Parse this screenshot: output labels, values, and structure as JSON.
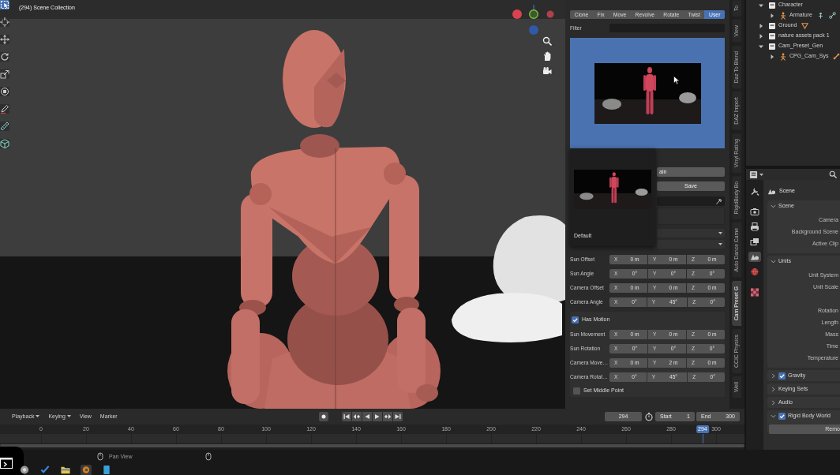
{
  "viewport": {
    "info": "(294) Scene Collection",
    "tools": [
      {
        "kind": "select",
        "selected": true
      },
      {
        "kind": "cursor",
        "selected": false
      },
      {
        "kind": "move",
        "selected": false
      },
      {
        "kind": "rotate",
        "selected": false
      },
      {
        "kind": "scale",
        "selected": false
      },
      {
        "kind": "transform",
        "selected": false
      },
      {
        "kind": "annotate",
        "selected": false
      },
      {
        "kind": "measure",
        "selected": false
      },
      {
        "kind": "add",
        "selected": false
      }
    ],
    "nav_buttons": [
      {
        "kind": "zoom"
      },
      {
        "kind": "pan"
      },
      {
        "kind": "camera"
      }
    ]
  },
  "n_panel": {
    "modes": [
      {
        "label": "Clone",
        "selected": false
      },
      {
        "label": "Fix",
        "selected": false
      },
      {
        "label": "Move",
        "selected": false
      },
      {
        "label": "Revolve",
        "selected": false
      },
      {
        "label": "Rotate",
        "selected": false
      },
      {
        "label": "Twist",
        "selected": false
      },
      {
        "label": "User",
        "selected": true
      }
    ],
    "filter": {
      "label": "Filter"
    },
    "popup": {
      "label": "Default"
    },
    "name_field": {
      "value": "ain"
    },
    "save_button": "Save",
    "offsets": [
      {
        "label": "Sun Offset",
        "values": [
          {
            "axis": "X",
            "value": "0 m"
          },
          {
            "axis": "Y",
            "value": "0 m"
          },
          {
            "axis": "Z",
            "value": "0 m"
          }
        ]
      },
      {
        "label": "Sun Angle",
        "values": [
          {
            "axis": "X",
            "value": "0°"
          },
          {
            "axis": "Y",
            "value": "0°"
          },
          {
            "axis": "Z",
            "value": "0°"
          }
        ]
      },
      {
        "label": "Camera Offset",
        "values": [
          {
            "axis": "X",
            "value": "0 m"
          },
          {
            "axis": "Y",
            "value": "0 m"
          },
          {
            "axis": "Z",
            "value": "0 m"
          }
        ]
      },
      {
        "label": "Camera Angle",
        "values": [
          {
            "axis": "X",
            "value": "0°"
          },
          {
            "axis": "Y",
            "value": "45°"
          },
          {
            "axis": "Z",
            "value": "0°"
          }
        ]
      }
    ],
    "has_motion": {
      "label": "Has Motion",
      "checked": true
    },
    "motion": [
      {
        "label": "Sun Movement",
        "values": [
          {
            "axis": "X",
            "value": "0 m"
          },
          {
            "axis": "Y",
            "value": "0 m"
          },
          {
            "axis": "Z",
            "value": "0 m"
          }
        ]
      },
      {
        "label": "Sun Rotation",
        "values": [
          {
            "axis": "X",
            "value": "0°"
          },
          {
            "axis": "Y",
            "value": "0°"
          },
          {
            "axis": "Z",
            "value": "0°"
          }
        ]
      },
      {
        "label": "Camera Move…",
        "values": [
          {
            "axis": "X",
            "value": "0 m"
          },
          {
            "axis": "Y",
            "value": "2 m"
          },
          {
            "axis": "Z",
            "value": "0 m"
          }
        ]
      },
      {
        "label": "Camera Rotat…",
        "values": [
          {
            "axis": "X",
            "value": "0°"
          },
          {
            "axis": "Y",
            "value": "45°"
          },
          {
            "axis": "Z",
            "value": "0°"
          }
        ]
      }
    ],
    "middle_point": {
      "label": "Set Middle Point",
      "checked": false
    }
  },
  "side_tabs": [
    {
      "label": "To",
      "selected": false
    },
    {
      "label": "View",
      "selected": false
    },
    {
      "label": "Daz To Blend",
      "selected": false
    },
    {
      "label": "DAZ Import",
      "selected": false
    },
    {
      "label": "Vinyl Rating",
      "selected": false
    },
    {
      "label": "RigidBody Bo",
      "selected": false
    },
    {
      "label": "Auto Dance Came",
      "selected": false
    },
    {
      "label": "Cam Preset G",
      "selected": true
    },
    {
      "label": "CCIC Physics",
      "selected": false
    },
    {
      "label": "Well",
      "selected": false
    }
  ],
  "outliner": {
    "items": [
      {
        "label": "Character",
        "kind": "collection",
        "expanded": true,
        "children": [
          {
            "label": "Armature",
            "kind": "armature",
            "expanded": false,
            "data_icons": [
              {
                "kind": "pose"
              },
              {
                "kind": "constraint"
              }
            ]
          }
        ]
      },
      {
        "label": "Ground",
        "kind": "collection",
        "expanded": false,
        "data_icons": [
          {
            "kind": "mesh"
          }
        ]
      },
      {
        "label": "nature assets pack 1",
        "kind": "collection",
        "expanded": false
      },
      {
        "label": "Cam_Preset_Gen",
        "kind": "collection",
        "expanded": true,
        "children": [
          {
            "label": "CPG_Cam_Sys",
            "kind": "armature",
            "expanded": false,
            "data_icons": [
              {
                "kind": "bone"
              }
            ]
          }
        ]
      }
    ]
  },
  "properties": {
    "tab_groups": [
      [
        {
          "kind": "tool",
          "selected": false
        }
      ],
      [
        {
          "kind": "render",
          "selected": false
        },
        {
          "kind": "output",
          "selected": false
        },
        {
          "kind": "view_layer",
          "selected": false
        },
        {
          "kind": "scene",
          "selected": true
        },
        {
          "kind": "world",
          "selected": false
        }
      ],
      [
        {
          "kind": "texture",
          "selected": false
        }
      ]
    ],
    "title": "Scene",
    "panels": [
      {
        "label": "Scene",
        "kind": "plain",
        "expanded": true,
        "field_groups": [
          [
            "Camera",
            "Background Scene",
            "Active Clip"
          ]
        ]
      },
      {
        "label": "Units",
        "kind": "plain",
        "expanded": true,
        "field_groups": [
          [
            "Unit System",
            "Unit Scale"
          ],
          [
            "Rotation",
            "Length",
            "Mass",
            "Time",
            "Temperature"
          ]
        ]
      },
      {
        "label": "Gravity",
        "kind": "toggle",
        "expanded": false,
        "checked": true
      },
      {
        "label": "Keying Sets",
        "kind": "plain",
        "expanded": false
      },
      {
        "label": "Audio",
        "kind": "plain",
        "expanded": false
      },
      {
        "label": "Rigid Body World",
        "kind": "toggle",
        "expanded": true,
        "checked": true,
        "button": "Remo"
      }
    ]
  },
  "timeline": {
    "menus": [
      {
        "label": "Playback",
        "dropdown": true
      },
      {
        "label": "Keying",
        "dropdown": true
      },
      {
        "label": "View",
        "dropdown": false
      },
      {
        "label": "Marker",
        "dropdown": false
      }
    ],
    "transport": [
      {
        "kind": "jump_start"
      },
      {
        "kind": "prev_key"
      },
      {
        "kind": "play_reverse"
      },
      {
        "kind": "play"
      },
      {
        "kind": "next_key"
      },
      {
        "kind": "jump_end"
      }
    ],
    "current_frame": "294",
    "start": {
      "label": "Start",
      "value": "1"
    },
    "end": {
      "label": "End",
      "value": "300"
    },
    "ruler": [
      "0",
      "20",
      "40",
      "60",
      "80",
      "100",
      "120",
      "140",
      "160",
      "180",
      "200",
      "220",
      "240",
      "260",
      "280",
      "300"
    ],
    "playhead": {
      "label": "294",
      "level": 0.98
    }
  },
  "status_bar": {
    "hint": "Pan View"
  },
  "taskbar": {
    "apps": [
      {
        "kind": "browser",
        "selected": false
      },
      {
        "kind": "tasks",
        "selected": false
      },
      {
        "kind": "files",
        "selected": false
      },
      {
        "kind": "blender",
        "selected": true
      },
      {
        "kind": "tablet",
        "selected": false
      }
    ]
  }
}
